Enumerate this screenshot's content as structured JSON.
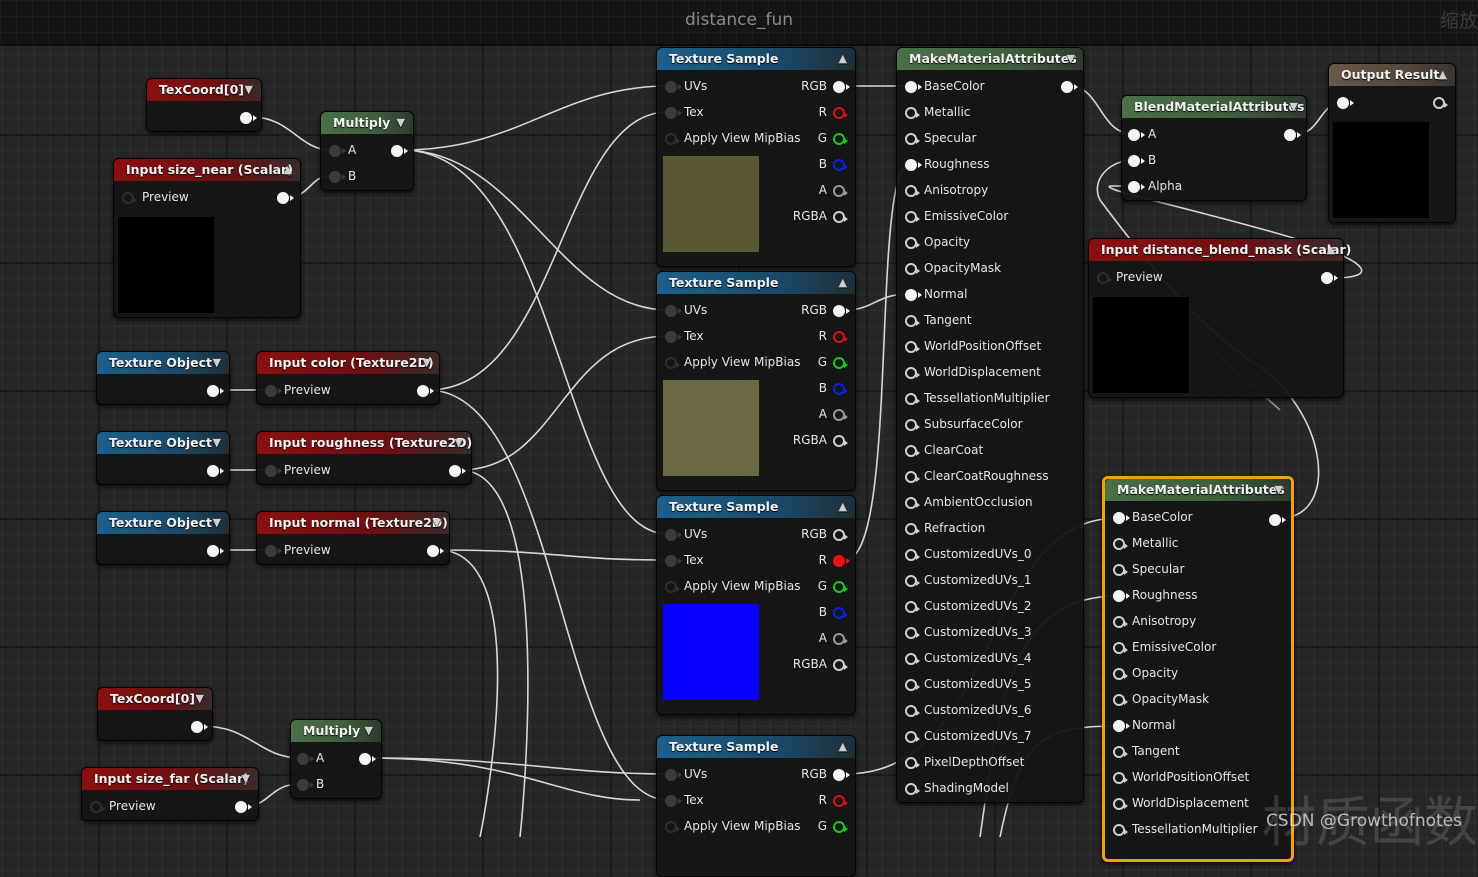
{
  "graph": {
    "title": "distance_fun",
    "zoom_label": "缩放",
    "watermark": "CSDN @Growthofnotes",
    "watermark_bg": "材质函数"
  },
  "colors": {
    "selection": "#f0a30a",
    "param_header": "#8a1010",
    "op_header": "#4a7048",
    "texture_header": "#1d5f8a",
    "output_header": "#6a584a",
    "preview_color": "#5a5832",
    "preview_roughness": "#6b6842",
    "preview_normal": "#0a00ff"
  },
  "nodes": {
    "texcoord_near": {
      "title": "TexCoord[0]"
    },
    "size_near": {
      "title": "Input size_near (Scalar)",
      "pin": "Preview"
    },
    "multiply_near": {
      "title": "Multiply",
      "pin_a": "A",
      "pin_b": "B"
    },
    "texobj_1": {
      "title": "Texture Object"
    },
    "texobj_2": {
      "title": "Texture Object"
    },
    "texobj_3": {
      "title": "Texture Object"
    },
    "input_color": {
      "title": "Input color (Texture2D)",
      "pin": "Preview"
    },
    "input_roughness": {
      "title": "Input roughness (Texture2D)",
      "pin": "Preview"
    },
    "input_normal": {
      "title": "Input normal (Texture2D)",
      "pin": "Preview"
    },
    "texcoord_far": {
      "title": "TexCoord[0]"
    },
    "size_far": {
      "title": "Input size_far (Scalar)",
      "pin": "Preview"
    },
    "multiply_far": {
      "title": "Multiply",
      "pin_a": "A",
      "pin_b": "B"
    },
    "texture_sample": {
      "title": "Texture Sample",
      "inputs": [
        "UVs",
        "Tex",
        "Apply View MipBias"
      ],
      "outputs": [
        "RGB",
        "R",
        "G",
        "B",
        "A",
        "RGBA"
      ]
    },
    "make_attrs": {
      "title": "MakeMaterialAttributes",
      "pins": [
        "BaseColor",
        "Metallic",
        "Specular",
        "Roughness",
        "Anisotropy",
        "EmissiveColor",
        "Opacity",
        "OpacityMask",
        "Normal",
        "Tangent",
        "WorldPositionOffset",
        "WorldDisplacement",
        "TessellationMultiplier",
        "SubsurfaceColor",
        "ClearCoat",
        "ClearCoatRoughness",
        "AmbientOcclusion",
        "Refraction",
        "CustomizedUVs_0",
        "CustomizedUVs_1",
        "CustomizedUVs_2",
        "CustomizedUVs_3",
        "CustomizedUVs_4",
        "CustomizedUVs_5",
        "CustomizedUVs_6",
        "CustomizedUVs_7",
        "PixelDepthOffset",
        "ShadingModel"
      ]
    },
    "blend": {
      "title": "BlendMaterialAttributes",
      "pins": [
        "A",
        "B",
        "Alpha"
      ]
    },
    "output": {
      "title": "Output Result"
    },
    "blend_mask": {
      "title": "Input distance_blend_mask (Scalar)",
      "pin": "Preview"
    }
  }
}
